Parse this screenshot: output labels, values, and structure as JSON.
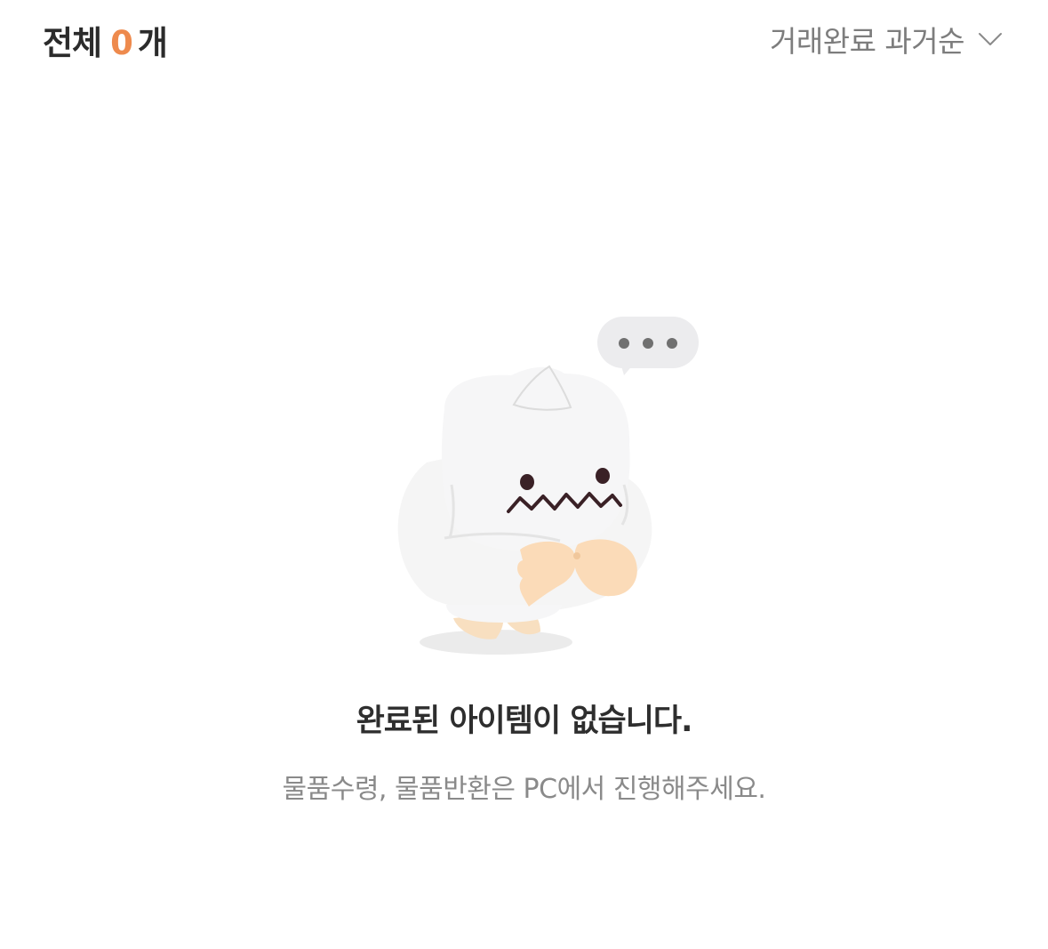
{
  "header": {
    "total_label": "전체",
    "total_count": "0",
    "total_unit": "개",
    "sort_label": "거래완료 과거순"
  },
  "empty_state": {
    "title": "완료된 아이템이 없습니다.",
    "subtitle": "물품수령, 물품반환은 PC에서 진행해주세요."
  },
  "colors": {
    "accent": "#ee8a4d",
    "text_primary": "#2b2b2b",
    "text_secondary": "#8a8a8a"
  },
  "icons": {
    "sort": "chevron-down-icon",
    "illustration": "confused-ghost-character-with-speech-bubble"
  }
}
